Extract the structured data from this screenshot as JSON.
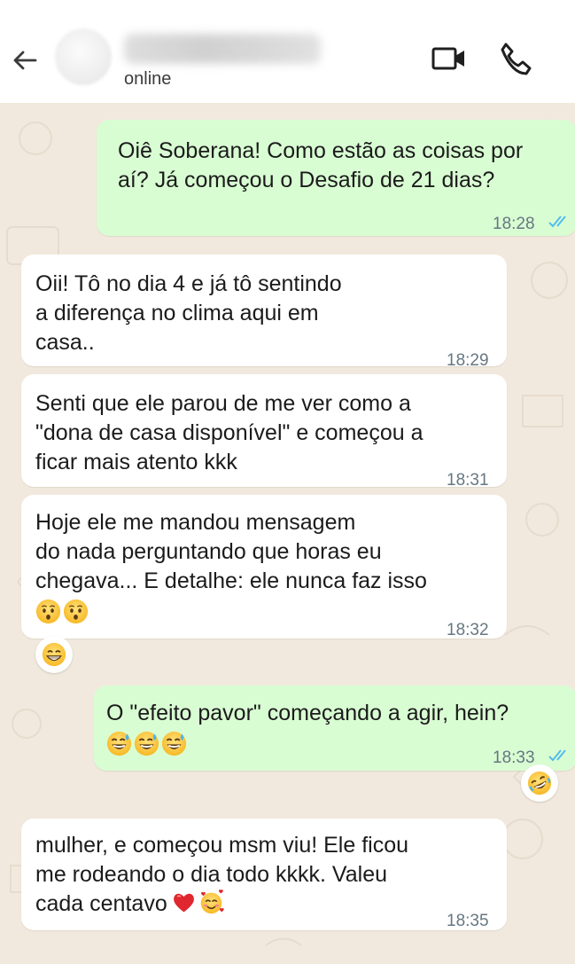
{
  "header": {
    "status": "online",
    "icons": [
      "back-arrow-icon",
      "video-call-icon",
      "phone-icon"
    ]
  },
  "messages": [
    {
      "direction": "outgoing",
      "lines": [
        "Oiê Soberana! Como estão as coisas por",
        "aí? Já começou o Desafio de 21 dias?"
      ],
      "time": "18:28",
      "read": true
    },
    {
      "direction": "incoming",
      "lines": [
        "Oii! Tô no dia 4 e já tô sentindo",
        "a diferença no clima aqui em",
        "casa.."
      ],
      "time": "18:29"
    },
    {
      "direction": "incoming",
      "lines": [
        "Senti que ele parou de me ver como a",
        "\"dona de casa disponível\" e começou a",
        "ficar mais atento kkk"
      ],
      "time": "18:31"
    },
    {
      "direction": "incoming",
      "lines": [
        "Hoje ele me mandou mensagem",
        "do nada perguntando que horas eu",
        "chegava... E detalhe: ele nunca faz isso"
      ],
      "emojis": [
        "hushed-face",
        "hushed-face"
      ],
      "time": "18:32",
      "reaction": "grinning-face"
    },
    {
      "direction": "outgoing",
      "lines": [
        "O \"efeito pavor\" começando a agir, hein?"
      ],
      "emojis": [
        "grinning-sweat-face",
        "grinning-sweat-face",
        "grinning-sweat-face"
      ],
      "time": "18:33",
      "read": true,
      "reaction": "rolling-laughing-face"
    },
    {
      "direction": "incoming",
      "lines": [
        "mulher, e começou msm viu! Ele ficou",
        "me rodeando o dia todo kkkk. Valeu",
        "cada centavo"
      ],
      "emojis": [
        "red-heart",
        "smiling-face-with-hearts"
      ],
      "time": "18:35"
    }
  ],
  "colors": {
    "outgoing": "#d9fdd3",
    "incoming": "#ffffff",
    "ticks": "#53bdeb",
    "wallpaper": "#f1e9dd"
  }
}
